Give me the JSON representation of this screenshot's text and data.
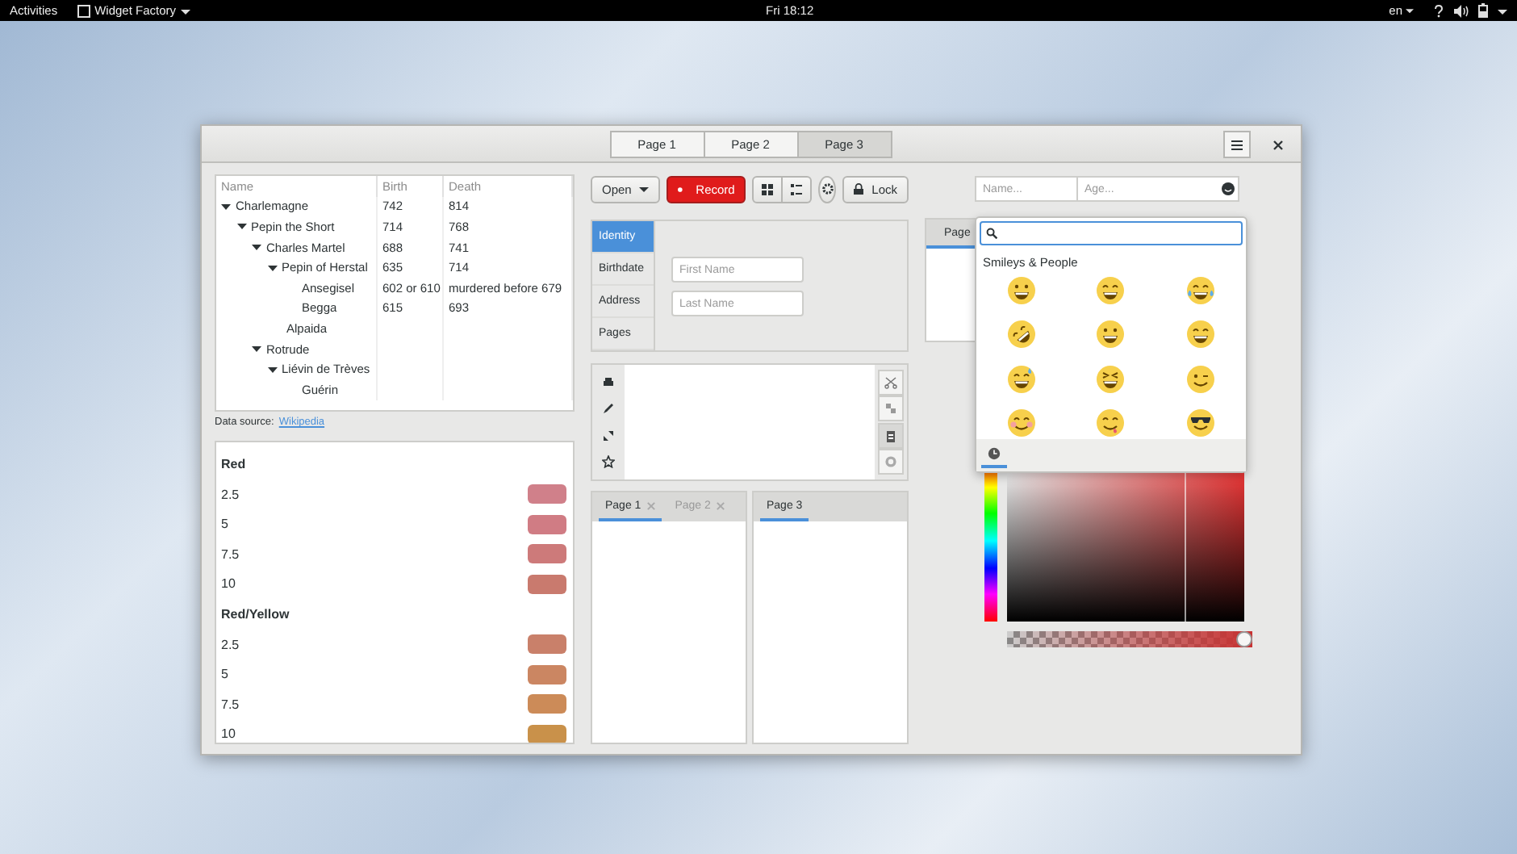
{
  "topbar": {
    "activities": "Activities",
    "app_menu": "Widget Factory",
    "clock": "Fri 18:12",
    "keyboard": "en"
  },
  "header": {
    "tabs": [
      {
        "label": "Page 1",
        "selected": false
      },
      {
        "label": "Page 2",
        "selected": false
      },
      {
        "label": "Page 3",
        "selected": true
      }
    ]
  },
  "tree": {
    "columns": [
      "Name",
      "Birth",
      "Death"
    ],
    "rows": [
      {
        "name": "Charlemagne",
        "birth": "742",
        "death": "814",
        "expanded": true,
        "children": [
          {
            "name": "Pepin the Short",
            "birth": "714",
            "death": "768",
            "expanded": true,
            "children": [
              {
                "name": "Charles Martel",
                "birth": "688",
                "death": "741",
                "expanded": true,
                "children": [
                  {
                    "name": "Pepin of Herstal",
                    "birth": "635",
                    "death": "714",
                    "expanded": true,
                    "children": [
                      {
                        "name": "Ansegisel",
                        "birth": "602 or 610",
                        "death": "murdered before 679"
                      },
                      {
                        "name": "Begga",
                        "birth": "615",
                        "death": "693"
                      }
                    ]
                  },
                  {
                    "name": "Alpaida"
                  }
                ]
              },
              {
                "name": "Rotrude",
                "expanded": true,
                "children": [
                  {
                    "name": "Liévin de Trèves",
                    "expanded": true,
                    "children": [
                      {
                        "name": "Guérin"
                      }
                    ]
                  }
                ]
              }
            ]
          }
        ]
      }
    ],
    "footer_label": "Data source:",
    "footer_link": "Wikipedia"
  },
  "color_list": {
    "groups": [
      {
        "title": "Red",
        "items": [
          {
            "label": "2.5",
            "color": "#d0808a"
          },
          {
            "label": "5",
            "color": "#d07c84"
          },
          {
            "label": "7.5",
            "color": "#cd7a7a"
          },
          {
            "label": "10",
            "color": "#c97a6e"
          }
        ]
      },
      {
        "title": "Red/Yellow",
        "items": [
          {
            "label": "2.5",
            "color": "#c9806a"
          },
          {
            "label": "5",
            "color": "#cb8662"
          },
          {
            "label": "7.5",
            "color": "#cc8b58"
          },
          {
            "label": "10",
            "color": "#c9914a"
          }
        ]
      }
    ]
  },
  "toolbar": {
    "open": "Open",
    "record": "Record",
    "view_toggles": [
      {
        "kind": "grid"
      },
      {
        "kind": "list"
      }
    ],
    "lock": "Lock"
  },
  "stack": {
    "items": [
      {
        "label": "Identity",
        "selected": true
      },
      {
        "label": "Birthdate",
        "selected": false
      },
      {
        "label": "Address",
        "selected": false
      },
      {
        "label": "Pages",
        "selected": false
      }
    ],
    "fields": [
      {
        "placeholder": "First Name"
      },
      {
        "placeholder": "Last Name"
      }
    ]
  },
  "text_view": {
    "left_tools": [
      {
        "kind": "printer"
      },
      {
        "kind": "dropper"
      },
      {
        "kind": "fullscreen"
      },
      {
        "kind": "star"
      }
    ],
    "right_tools": [
      {
        "kind": "cut",
        "pressed": false
      },
      {
        "kind": "copy",
        "pressed": false
      },
      {
        "kind": "paste",
        "pressed": true
      },
      {
        "kind": "clear",
        "pressed": false
      }
    ]
  },
  "notebooks": [
    {
      "tabs": [
        {
          "label": "Page 1",
          "closable": true,
          "selected": true
        },
        {
          "label": "Page 2",
          "closable": true,
          "selected": false
        }
      ]
    },
    {
      "tabs": [
        {
          "label": "Page 3",
          "closable": false,
          "selected": true
        }
      ]
    }
  ],
  "entries": {
    "name_placeholder": "Name...",
    "age_placeholder": "Age..."
  },
  "background_notebook": {
    "tab": "Page"
  },
  "emoji_chooser": {
    "section": "Smileys & People",
    "emojis": [
      {
        "kind": "grin"
      },
      {
        "kind": "beam"
      },
      {
        "kind": "tears"
      },
      {
        "kind": "rolling"
      },
      {
        "kind": "smile"
      },
      {
        "kind": "smile-eyes"
      },
      {
        "kind": "sweat"
      },
      {
        "kind": "squint"
      },
      {
        "kind": "wink"
      },
      {
        "kind": "blush"
      },
      {
        "kind": "yum"
      },
      {
        "kind": "cool"
      }
    ],
    "categories": [
      {
        "kind": "recent",
        "selected": true
      }
    ]
  },
  "color_editor": {
    "alpha": {
      "level": 1
    }
  }
}
